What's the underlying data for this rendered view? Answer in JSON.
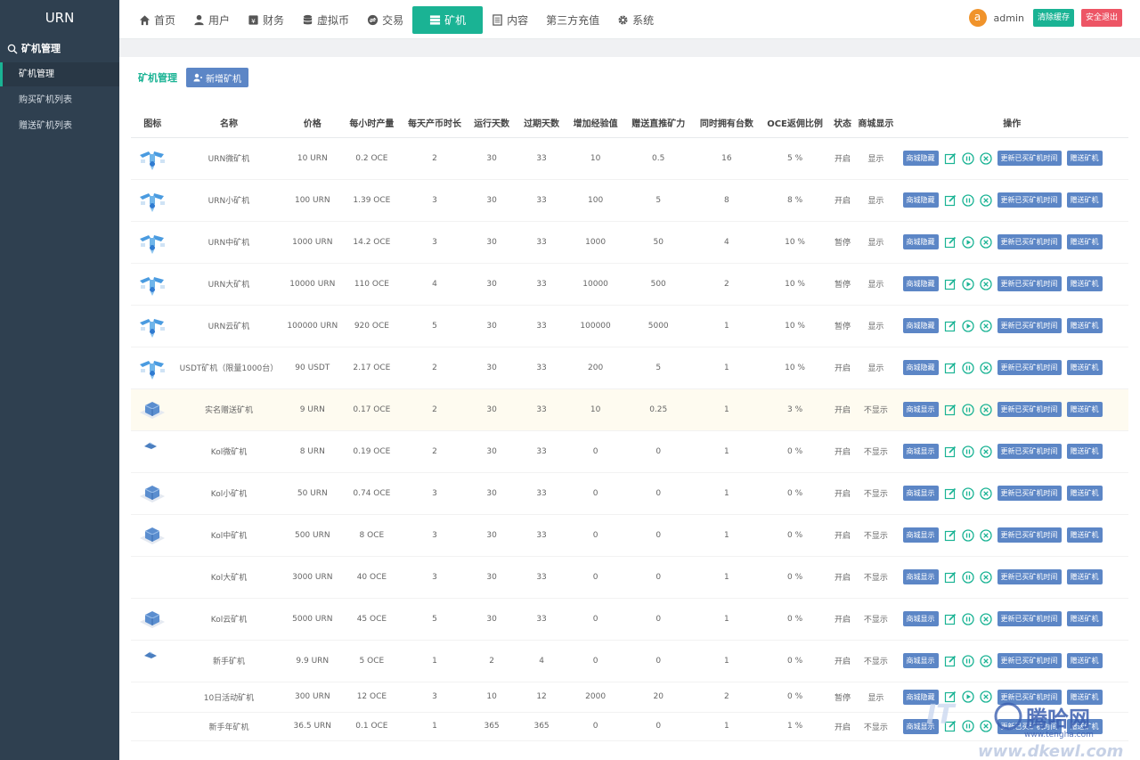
{
  "sidebar": {
    "brand": "URN",
    "group_label": "矿机管理",
    "items": [
      {
        "label": "矿机管理",
        "active": true
      },
      {
        "label": "购买矿机列表",
        "active": false
      },
      {
        "label": "赠送矿机列表",
        "active": false
      }
    ]
  },
  "topnav": {
    "items": [
      {
        "label": "首页",
        "icon": "home-icon"
      },
      {
        "label": "用户",
        "icon": "user-icon"
      },
      {
        "label": "财务",
        "icon": "finance-icon"
      },
      {
        "label": "虚拟币",
        "icon": "database-icon"
      },
      {
        "label": "交易",
        "icon": "exchange-icon"
      },
      {
        "label": "矿机",
        "icon": "server-icon",
        "active": true
      },
      {
        "label": "内容",
        "icon": "document-icon"
      },
      {
        "label": "第三方充值",
        "icon": ""
      },
      {
        "label": "系统",
        "icon": "gear-icon"
      }
    ],
    "avatar_letter": "a",
    "username": "admin",
    "clear_cache": "清除缓存",
    "logout": "安全退出"
  },
  "panel": {
    "title": "矿机管理",
    "add_button": "新增矿机"
  },
  "table": {
    "headers": [
      "图标",
      "名称",
      "价格",
      "每小时产量",
      "每天产币时长",
      "运行天数",
      "过期天数",
      "增加经验值",
      "赠送直推矿力",
      "同时拥有台数",
      "OCE返佣比例",
      "状态",
      "商城显示",
      "操作"
    ],
    "action_labels": {
      "show": "商城显示",
      "hide": "商城隐藏",
      "update_time": "更新已买矿机时间",
      "gift": "赠送矿机"
    },
    "rows": [
      {
        "name": "URN微矿机",
        "price": "10 URN",
        "hourly": "0.2 OCE",
        "daily_hours": "2",
        "run_days": "30",
        "expire_days": "33",
        "exp": "10",
        "gift_power": "0.5",
        "max_own": "16",
        "ratio": "5 %",
        "status": "开启",
        "mall": "显示",
        "toggle": "商城隐藏",
        "thumb": "drone",
        "paused": false
      },
      {
        "name": "URN小矿机",
        "price": "100 URN",
        "hourly": "1.39 OCE",
        "daily_hours": "3",
        "run_days": "30",
        "expire_days": "33",
        "exp": "100",
        "gift_power": "5",
        "max_own": "8",
        "ratio": "8 %",
        "status": "开启",
        "mall": "显示",
        "toggle": "商城隐藏",
        "thumb": "drone",
        "paused": false
      },
      {
        "name": "URN中矿机",
        "price": "1000 URN",
        "hourly": "14.2 OCE",
        "daily_hours": "3",
        "run_days": "30",
        "expire_days": "33",
        "exp": "1000",
        "gift_power": "50",
        "max_own": "4",
        "ratio": "10 %",
        "status": "暂停",
        "mall": "显示",
        "toggle": "商城隐藏",
        "thumb": "drone",
        "paused": true
      },
      {
        "name": "URN大矿机",
        "price": "10000 URN",
        "hourly": "110 OCE",
        "daily_hours": "4",
        "run_days": "30",
        "expire_days": "33",
        "exp": "10000",
        "gift_power": "500",
        "max_own": "2",
        "ratio": "10 %",
        "status": "暂停",
        "mall": "显示",
        "toggle": "商城隐藏",
        "thumb": "drone",
        "paused": true
      },
      {
        "name": "URN云矿机",
        "price": "100000 URN",
        "hourly": "920 OCE",
        "daily_hours": "5",
        "run_days": "30",
        "expire_days": "33",
        "exp": "100000",
        "gift_power": "5000",
        "max_own": "1",
        "ratio": "10 %",
        "status": "暂停",
        "mall": "显示",
        "toggle": "商城隐藏",
        "thumb": "drone",
        "paused": true
      },
      {
        "name": "USDT矿机（限量1000台）",
        "price": "90 USDT",
        "hourly": "2.17 OCE",
        "daily_hours": "2",
        "run_days": "30",
        "expire_days": "33",
        "exp": "200",
        "gift_power": "5",
        "max_own": "1",
        "ratio": "10 %",
        "status": "开启",
        "mall": "显示",
        "toggle": "商城隐藏",
        "thumb": "drone",
        "paused": false
      },
      {
        "name": "实名赠送矿机",
        "price": "9 URN",
        "hourly": "0.17 OCE",
        "daily_hours": "2",
        "run_days": "30",
        "expire_days": "33",
        "exp": "10",
        "gift_power": "0.25",
        "max_own": "1",
        "ratio": "3 %",
        "status": "开启",
        "mall": "不显示",
        "toggle": "商城显示",
        "thumb": "box",
        "paused": false,
        "highlight": true
      },
      {
        "name": "Kol微矿机",
        "price": "8 URN",
        "hourly": "0.19 OCE",
        "daily_hours": "2",
        "run_days": "30",
        "expire_days": "33",
        "exp": "0",
        "gift_power": "0",
        "max_own": "1",
        "ratio": "0 %",
        "status": "开启",
        "mall": "不显示",
        "toggle": "商城显示",
        "thumb": "flat",
        "paused": false
      },
      {
        "name": "Kol小矿机",
        "price": "50 URN",
        "hourly": "0.74 OCE",
        "daily_hours": "3",
        "run_days": "30",
        "expire_days": "33",
        "exp": "0",
        "gift_power": "0",
        "max_own": "1",
        "ratio": "0 %",
        "status": "开启",
        "mall": "不显示",
        "toggle": "商城显示",
        "thumb": "box",
        "paused": false
      },
      {
        "name": "Kol中矿机",
        "price": "500 URN",
        "hourly": "8 OCE",
        "daily_hours": "3",
        "run_days": "30",
        "expire_days": "33",
        "exp": "0",
        "gift_power": "0",
        "max_own": "1",
        "ratio": "0 %",
        "status": "开启",
        "mall": "不显示",
        "toggle": "商城显示",
        "thumb": "box",
        "paused": false
      },
      {
        "name": "Kol大矿机",
        "price": "3000 URN",
        "hourly": "40 OCE",
        "daily_hours": "3",
        "run_days": "30",
        "expire_days": "33",
        "exp": "0",
        "gift_power": "0",
        "max_own": "1",
        "ratio": "0 %",
        "status": "开启",
        "mall": "不显示",
        "toggle": "商城显示",
        "thumb": "none",
        "paused": false
      },
      {
        "name": "Kol云矿机",
        "price": "5000 URN",
        "hourly": "45 OCE",
        "daily_hours": "5",
        "run_days": "30",
        "expire_days": "33",
        "exp": "0",
        "gift_power": "0",
        "max_own": "1",
        "ratio": "0 %",
        "status": "开启",
        "mall": "不显示",
        "toggle": "商城显示",
        "thumb": "box",
        "paused": false
      },
      {
        "name": "新手矿机",
        "price": "9.9 URN",
        "hourly": "5 OCE",
        "daily_hours": "1",
        "run_days": "2",
        "expire_days": "4",
        "exp": "0",
        "gift_power": "0",
        "max_own": "1",
        "ratio": "0 %",
        "status": "开启",
        "mall": "不显示",
        "toggle": "商城显示",
        "thumb": "flat",
        "paused": false
      },
      {
        "name": "10日活动矿机",
        "price": "300 URN",
        "hourly": "12 OCE",
        "daily_hours": "3",
        "run_days": "10",
        "expire_days": "12",
        "exp": "2000",
        "gift_power": "20",
        "max_own": "2",
        "ratio": "0 %",
        "status": "暂停",
        "mall": "显示",
        "toggle": "商城隐藏",
        "thumb": "none",
        "paused": true,
        "row_class": "short"
      },
      {
        "name": "新手年矿机",
        "price": "36.5 URN",
        "hourly": "0.1 OCE",
        "daily_hours": "1",
        "run_days": "365",
        "expire_days": "365",
        "exp": "0",
        "gift_power": "0",
        "max_own": "1",
        "ratio": "1 %",
        "status": "开启",
        "mall": "不显示",
        "toggle": "商城显示",
        "thumb": "none",
        "paused": false,
        "row_class": "short2"
      }
    ]
  },
  "watermark": {
    "text": "腾哈网",
    "url1": "www.tengha.com",
    "url2": "www.dkewl.com"
  },
  "colors": {
    "accent": "#1ab394",
    "sidebar": "#2f4050",
    "action_blue": "#5c86c6",
    "danger": "#ed5565"
  }
}
